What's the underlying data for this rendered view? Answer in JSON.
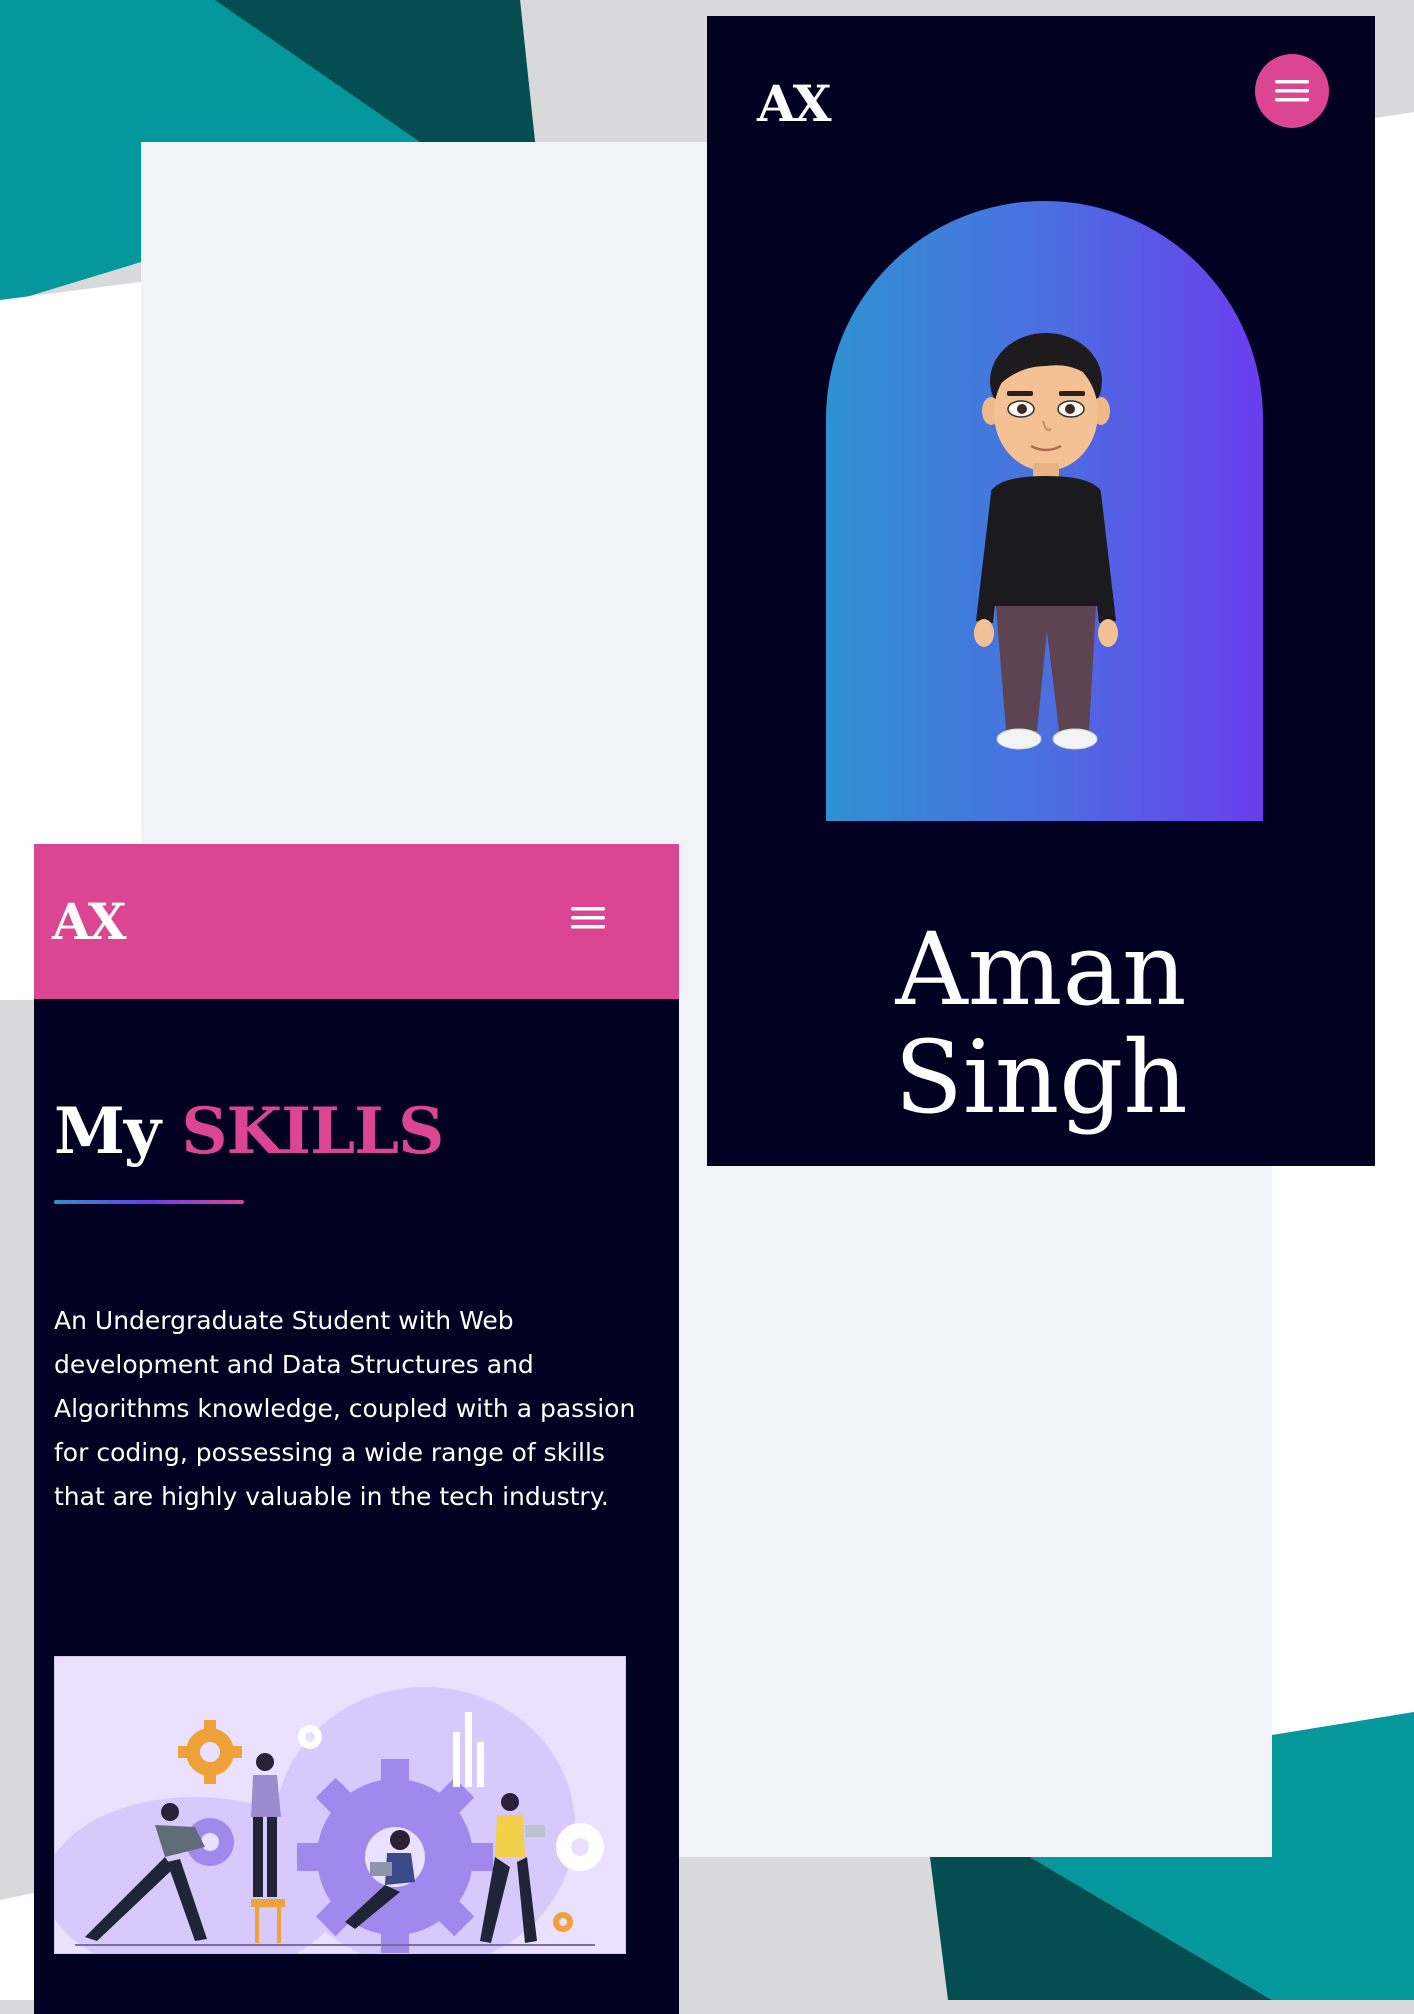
{
  "background": {
    "colors": {
      "teal": "#04979c",
      "dark_teal": "#044e52",
      "white": "#ffffff",
      "light_gray": "#d9d9db",
      "panel": "#f2f3f8"
    }
  },
  "hero_screen": {
    "logo": "AX",
    "menu_icon": "hamburger-menu-icon",
    "avatar_icon": "bitmoji-avatar",
    "name_first": "Aman",
    "name_last": "Singh",
    "colors": {
      "bg": "#020122",
      "accent": "#dc4592",
      "gradient_start": "#2e91d2",
      "gradient_end": "#6a3ded"
    }
  },
  "skills_screen": {
    "logo": "AX",
    "menu_icon": "hamburger-menu-icon",
    "title_prefix": "My",
    "title_accent": "SKILLS",
    "description": "An Undergraduate Student with Web development and Data Structures and Algorithms knowledge, coupled with a passion for coding, possessing a wide range of skills that are highly valuable in the tech industry.",
    "illustration": "teamwork-gears-illustration",
    "colors": {
      "header_bg": "#dc4592",
      "bg": "#020122",
      "text": "#ffffff"
    }
  }
}
